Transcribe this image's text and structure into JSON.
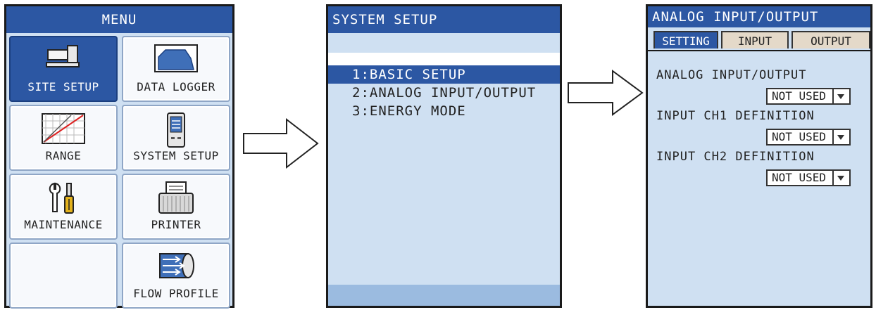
{
  "menu": {
    "title": "MENU",
    "tiles": [
      {
        "label": "SITE SETUP",
        "icon": "site-setup-icon",
        "selected": true
      },
      {
        "label": "DATA LOGGER",
        "icon": "data-logger-icon"
      },
      {
        "label": "RANGE",
        "icon": "range-icon"
      },
      {
        "label": "SYSTEM SETUP",
        "icon": "system-setup-icon"
      },
      {
        "label": "MAINTENANCE",
        "icon": "maintenance-icon"
      },
      {
        "label": "PRINTER",
        "icon": "printer-icon"
      },
      {
        "label": "",
        "icon": ""
      },
      {
        "label": "FLOW PROFILE",
        "icon": "flow-profile-icon"
      }
    ]
  },
  "system_setup": {
    "title": "SYSTEM SETUP",
    "items": [
      {
        "label": "1:BASIC SETUP",
        "selected": true
      },
      {
        "label": "2:ANALOG INPUT/OUTPUT"
      },
      {
        "label": "3:ENERGY MODE"
      }
    ]
  },
  "analog": {
    "title": "ANALOG INPUT/OUTPUT",
    "tabs": [
      {
        "label": "SETTING",
        "active": true
      },
      {
        "label": "INPUT"
      },
      {
        "label": "OUTPUT"
      }
    ],
    "fields": [
      {
        "label": "ANALOG INPUT/OUTPUT",
        "value": "NOT USED"
      },
      {
        "label": "INPUT CH1 DEFINITION",
        "value": "NOT USED"
      },
      {
        "label": "INPUT CH2 DEFINITION",
        "value": "NOT USED"
      }
    ]
  },
  "colors": {
    "title_bar": "#2c57a3",
    "panel_bg": "#cfe0f2",
    "inactive_tab": "#e4d9c9"
  }
}
